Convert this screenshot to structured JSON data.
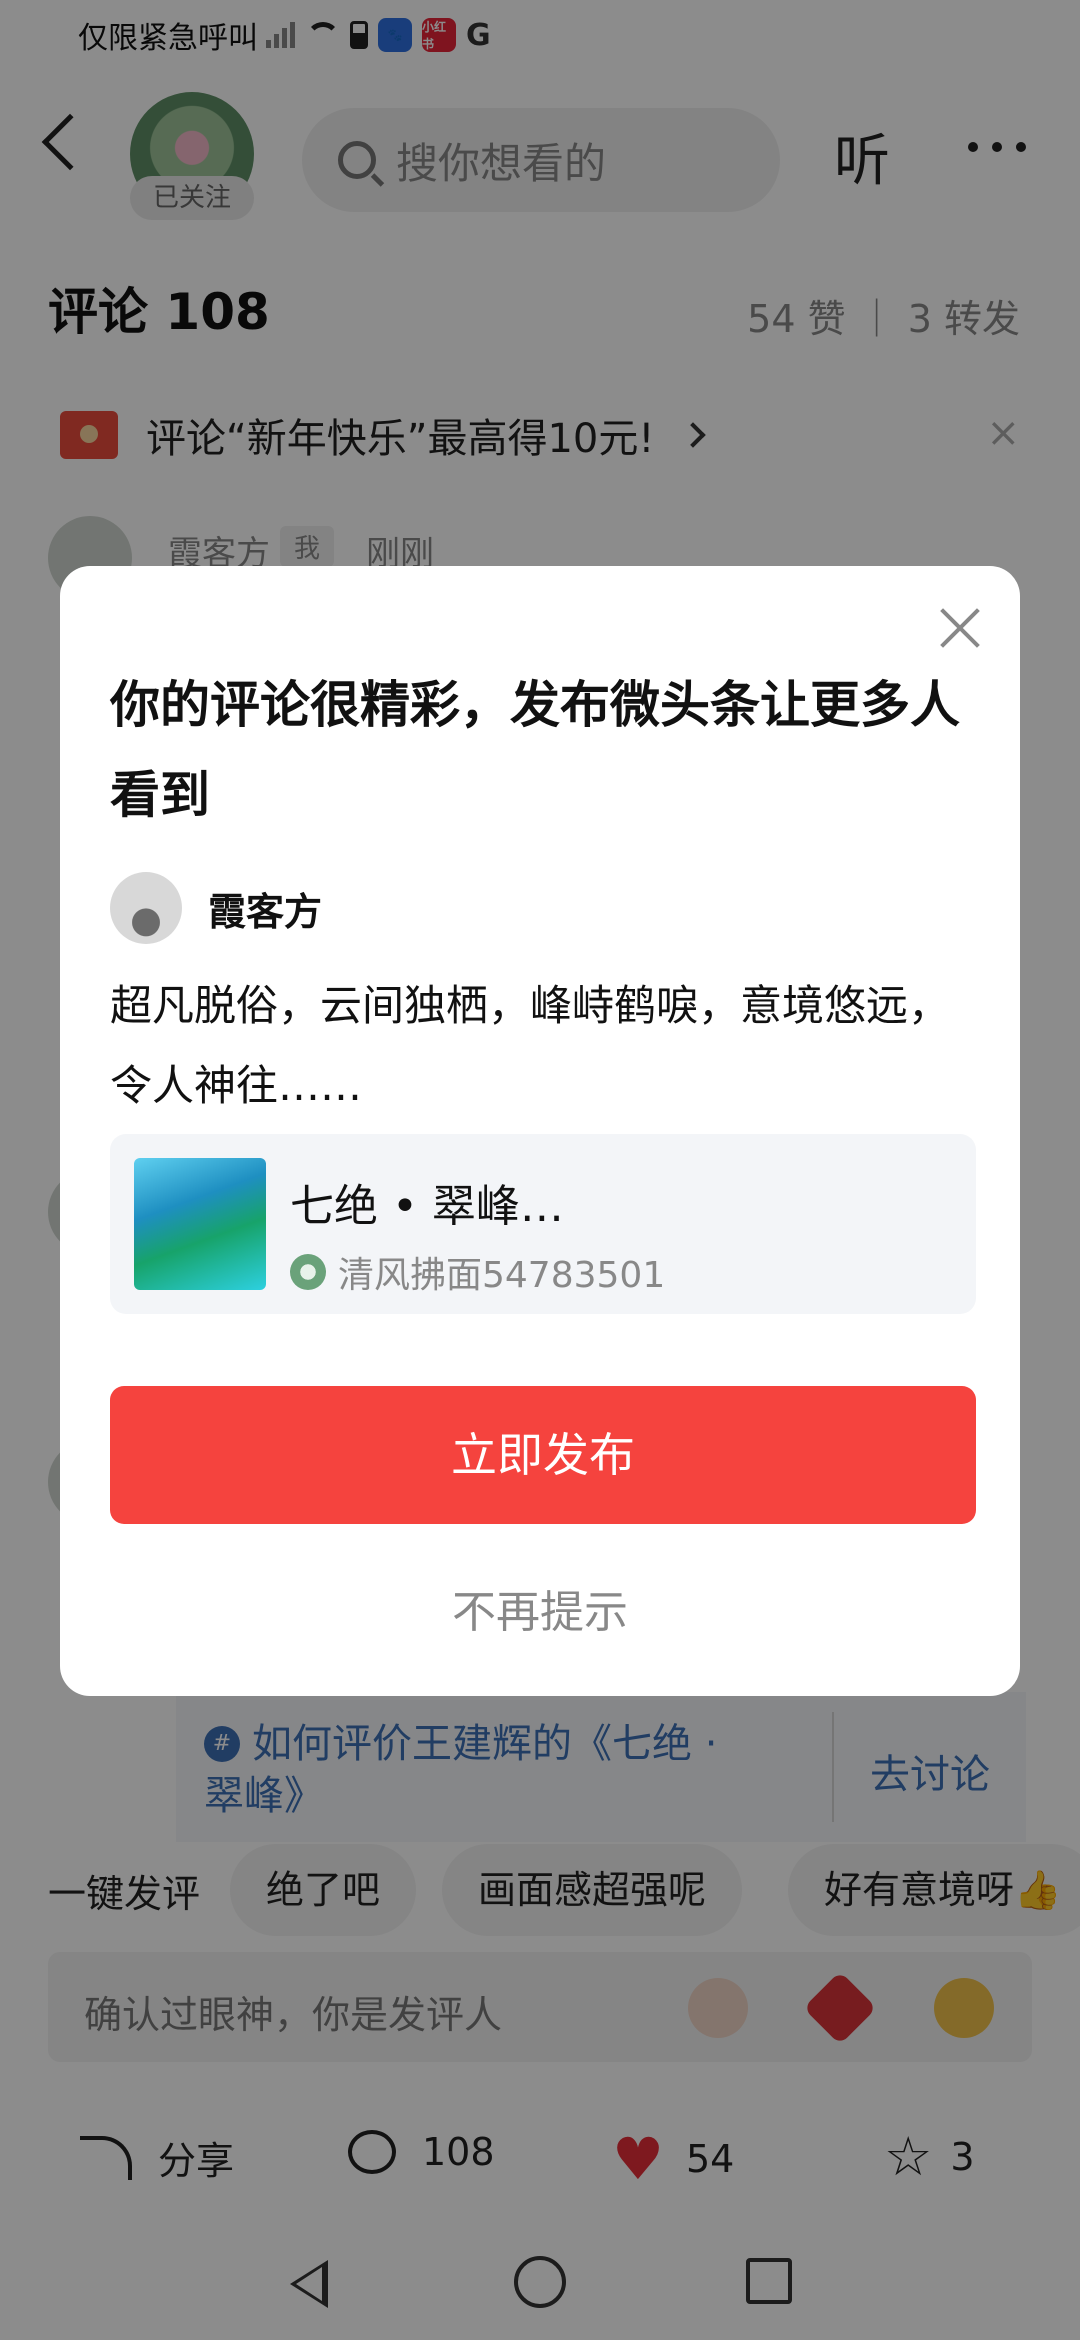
{
  "status_bar": {
    "carrier_text": "仅限紧急呼叫",
    "g_label": "G",
    "app_badge": "小红书"
  },
  "header": {
    "follow_tag": "已关注",
    "search_placeholder": "搜你想看的",
    "listen_label": "听"
  },
  "comments": {
    "title": "评论 108",
    "stats": "54 赞 ｜ 3 转发",
    "promo_text": "评论“新年快乐”最高得10元!",
    "promo_close": "×",
    "first": {
      "name": "霞客方",
      "me_tag": "我",
      "time": "刚刚"
    }
  },
  "topic": {
    "hash": "#",
    "text": "如何评价王建辉的《七绝 · 翠峰》",
    "discuss_label": "去讨论"
  },
  "quick_reply": {
    "label": "一键发评",
    "chips": [
      "绝了吧",
      "画面感超强呢",
      "好有意境呀👍"
    ]
  },
  "comment_input": {
    "placeholder": "确认过眼神，你是发评人"
  },
  "bottom_bar": {
    "share_label": "分享",
    "comment_count": "108",
    "like_count": "54",
    "star_count": "3"
  },
  "modal": {
    "title": "你的评论很精彩，发布微头条让更多人看到",
    "author": "霞客方",
    "comment": "超凡脱俗，云间独栖，峰峙鹤唳，意境悠远，令人神往……",
    "article_title": "七绝 • 翠峰…",
    "article_author": "清风拂面54783501",
    "publish_label": "立即发布",
    "dismiss_label": "不再提示"
  },
  "colors": {
    "accent_red": "#f5433e",
    "link_blue": "#3d6fb4",
    "like_red": "#e52e3a"
  }
}
